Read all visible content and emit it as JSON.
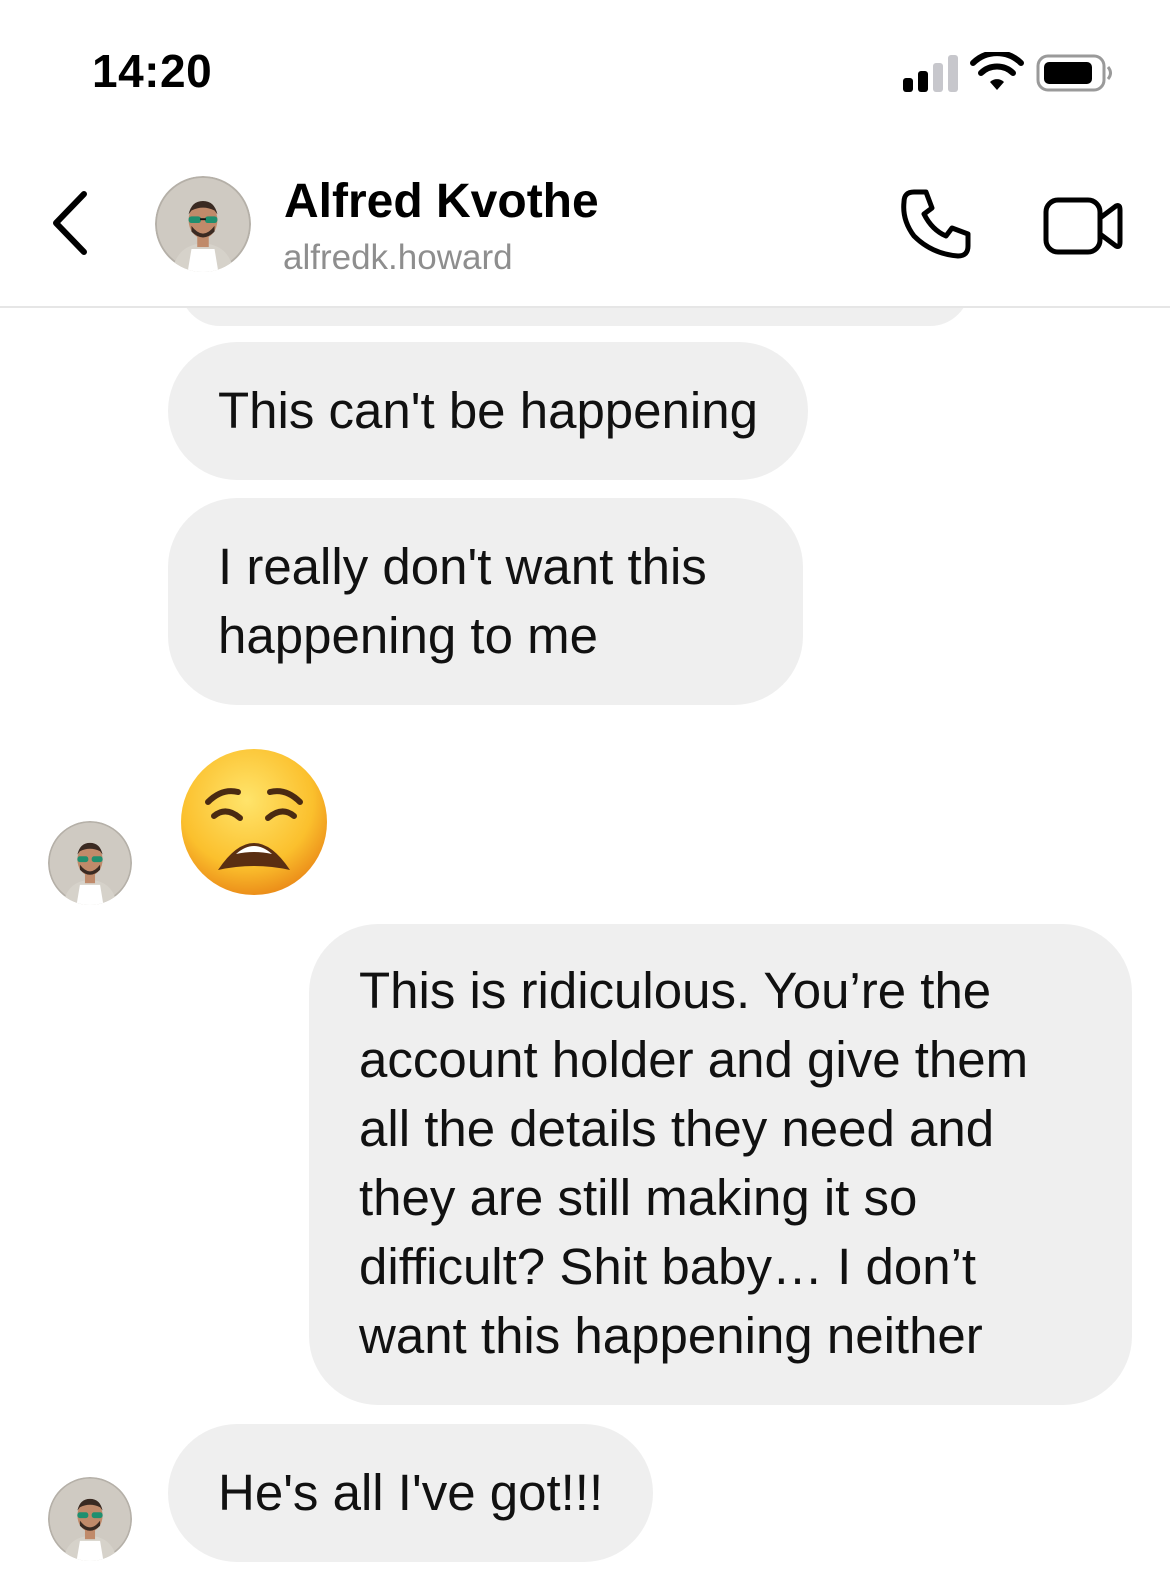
{
  "status_bar": {
    "time": "14:20",
    "icons": [
      "cellular-signal-icon",
      "wifi-icon",
      "battery-icon"
    ]
  },
  "header": {
    "back_icon": "chevron-left-icon",
    "contact_name": "Alfred Kvothe",
    "username": "alfredk.howard",
    "actions": [
      "phone-call-icon",
      "video-call-icon"
    ]
  },
  "messages": [
    {
      "sender": "contact",
      "text": "This can't be happening"
    },
    {
      "sender": "contact",
      "text": "I really don't want this happening to me"
    },
    {
      "sender": "contact",
      "emoji": "weary-face-emoji"
    },
    {
      "sender": "me",
      "text": "This is ridiculous. You’re the account holder and give them all the details they need and they are still making it so difficult? Shit baby… I don’t want this happening neither"
    },
    {
      "sender": "contact",
      "text": "He's all I've got!!!"
    }
  ],
  "colors": {
    "bubble": "#efefef",
    "secondary_text": "#8e8e8e",
    "divider": "#e6e6e6"
  }
}
